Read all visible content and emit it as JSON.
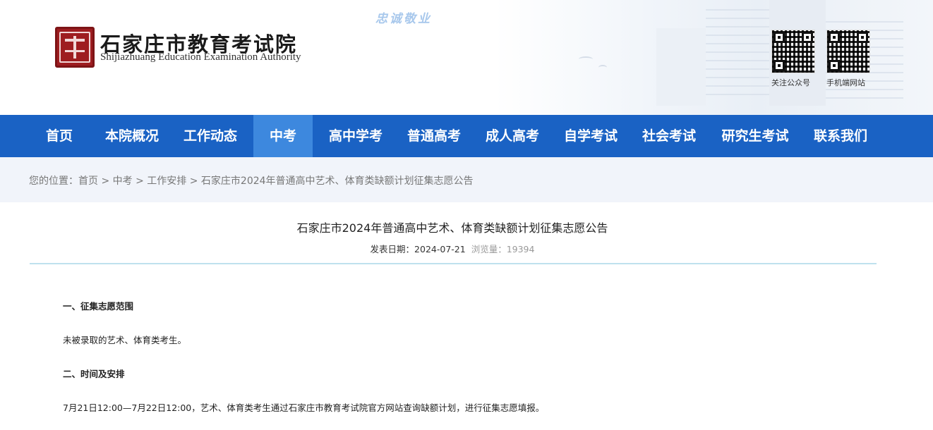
{
  "header": {
    "slogan": "忠诚敬业",
    "org_name_cn": "石家庄市教育考试院",
    "org_name_en": "Shijiazhuang Education Examination Authority",
    "qr_codes": [
      {
        "label": "关注公众号",
        "icon": "qr-code-icon"
      },
      {
        "label": "手机端网站",
        "icon": "qr-code-icon"
      }
    ]
  },
  "nav": {
    "active": "中考",
    "items": [
      {
        "label": "首页"
      },
      {
        "label": "本院概况"
      },
      {
        "label": "工作动态"
      },
      {
        "label": "中考"
      },
      {
        "label": "高中学考"
      },
      {
        "label": "普通高考"
      },
      {
        "label": "成人高考"
      },
      {
        "label": "自学考试"
      },
      {
        "label": "社会考试"
      },
      {
        "label": "研究生考试"
      },
      {
        "label": "联系我们"
      }
    ]
  },
  "breadcrumb": {
    "prefix": "您的位置：",
    "items": [
      "首页",
      "中考",
      "工作安排",
      "石家庄市2024年普通高中艺术、体育类缺额计划征集志愿公告"
    ],
    "separator": " > "
  },
  "article": {
    "title": "石家庄市2024年普通高中艺术、体育类缺额计划征集志愿公告",
    "date_label": "发表日期：",
    "date": "2024-07-21",
    "views_label": "浏览量：",
    "views": "19394",
    "paragraphs": [
      {
        "text": "一、征集志愿范围",
        "bold": true
      },
      {
        "text": "未被录取的艺术、体育类考生。",
        "bold": false
      },
      {
        "text": "二、时间及安排",
        "bold": true
      },
      {
        "text": "7月21日12:00—7月22日12:00，艺术、体育类考生通过石家庄市教育考试院官方网站查询缺额计划，进行征集志愿填报。",
        "bold": false
      }
    ]
  },
  "colors": {
    "nav_bg": "#1a62c4",
    "nav_active": "#3d88de",
    "breadcrumb_bg": "#f1f4fa",
    "seal_red": "#9e1d20",
    "rule": "#bfe1ee"
  }
}
